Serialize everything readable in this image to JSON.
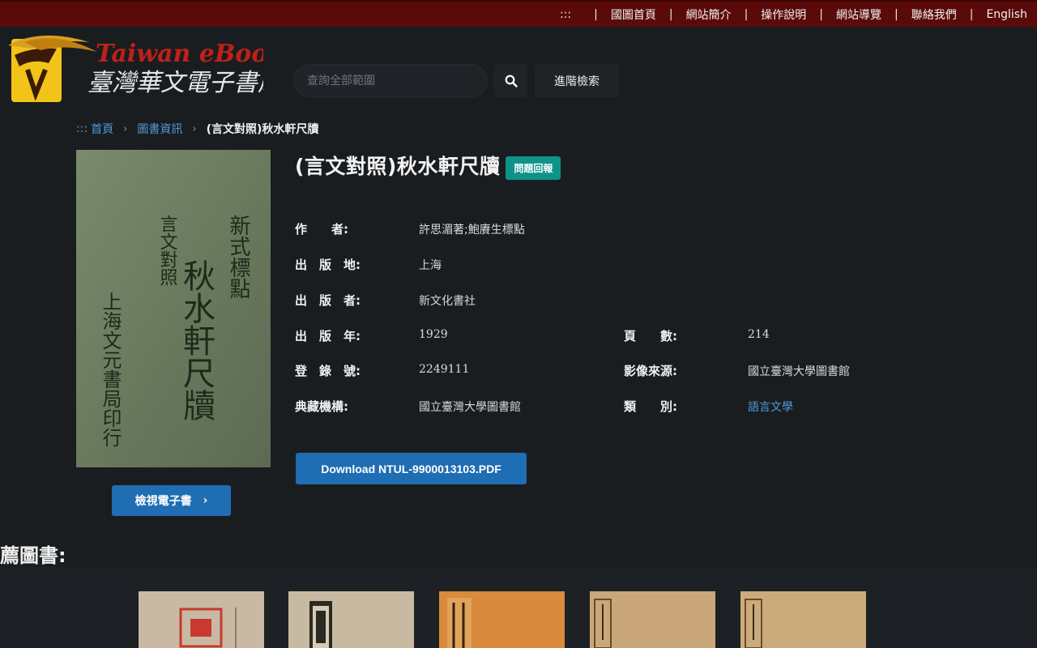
{
  "topnav": {
    "accessibility": ":::",
    "sep": "|",
    "items": [
      "國圖首頁",
      "網站簡介",
      "操作說明",
      "網站導覽",
      "聯絡我們",
      "English"
    ]
  },
  "logo": {
    "text_en": "Taiwan eBook",
    "text_zh": "臺灣華文電子書庫"
  },
  "search": {
    "placeholder": "查詢全部範圍",
    "advanced_label": "進階檢索"
  },
  "breadcrumb": {
    "prefix": ":::",
    "home": "首頁",
    "section": "圖書資訊",
    "current": "(言文對照)秋水軒尺牘"
  },
  "cover": {
    "text_right": "新式標點",
    "text_small": "言文對照",
    "text_main": "秋水軒尺牘",
    "text_left": "上海文元書局印行"
  },
  "book": {
    "title": "(言文對照)秋水軒尺牘",
    "report_label": "問題回報",
    "fields": [
      {
        "label": "作　　者:",
        "value": "許思湄著;鮑賡生標點"
      },
      {
        "label": "出　版　地:",
        "value": "上海"
      },
      {
        "label": "出　版　者:",
        "value": "新文化書社"
      },
      {
        "label": "出　版　年:",
        "value": "1929"
      },
      {
        "label": "登　錄　號:",
        "value": "2249111"
      },
      {
        "label": "典藏機構:",
        "value": "國立臺灣大學圖書館"
      }
    ],
    "fields_right": [
      {
        "label": "頁　　數:",
        "value": "214"
      },
      {
        "label": "影像來源:",
        "value": "國立臺灣大學圖書館"
      },
      {
        "label": "類　　別:",
        "value": "語言文學"
      }
    ],
    "download_label": "Download NTUL-9900013103.PDF",
    "view_label": "檢視電子書"
  },
  "recommend": {
    "title": "薦圖書:"
  },
  "colors": {
    "topbar": "#5a0a08",
    "background": "#1a1d20",
    "primary": "#1f6db3",
    "badge": "#0f9388",
    "link": "#4f9ad8"
  }
}
